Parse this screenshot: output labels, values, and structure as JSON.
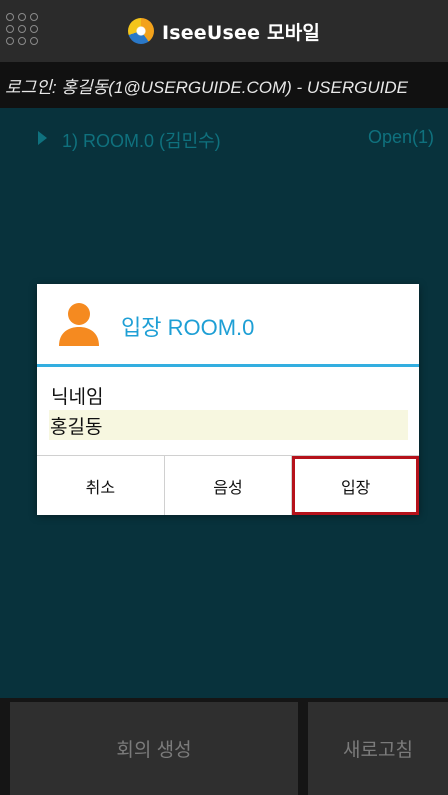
{
  "header": {
    "app_title": "IseeUsee 모바일",
    "menu_icon": "grid-menu-icon",
    "logo_icon": "app-logo-icon"
  },
  "login": {
    "text": "로그인: 홍길동(1@USERGUIDE.COM) - USERGUIDE"
  },
  "rooms": [
    {
      "label": "1) ROOM.0 (김민수)",
      "status": "Open(1)"
    }
  ],
  "dialog": {
    "title": "입장 ROOM.0",
    "icon": "person-icon",
    "nickname_label": "닉네임",
    "nickname_value": "홍길동",
    "buttons": {
      "cancel": "취소",
      "voice": "음성",
      "enter": "입장"
    }
  },
  "footer": {
    "create_label": "회의 생성",
    "refresh_label": "새로고침"
  },
  "colors": {
    "accent": "#1e9fd5",
    "highlight": "#b5121b",
    "content_bg": "#0b4350",
    "room_text": "#1597a8"
  }
}
